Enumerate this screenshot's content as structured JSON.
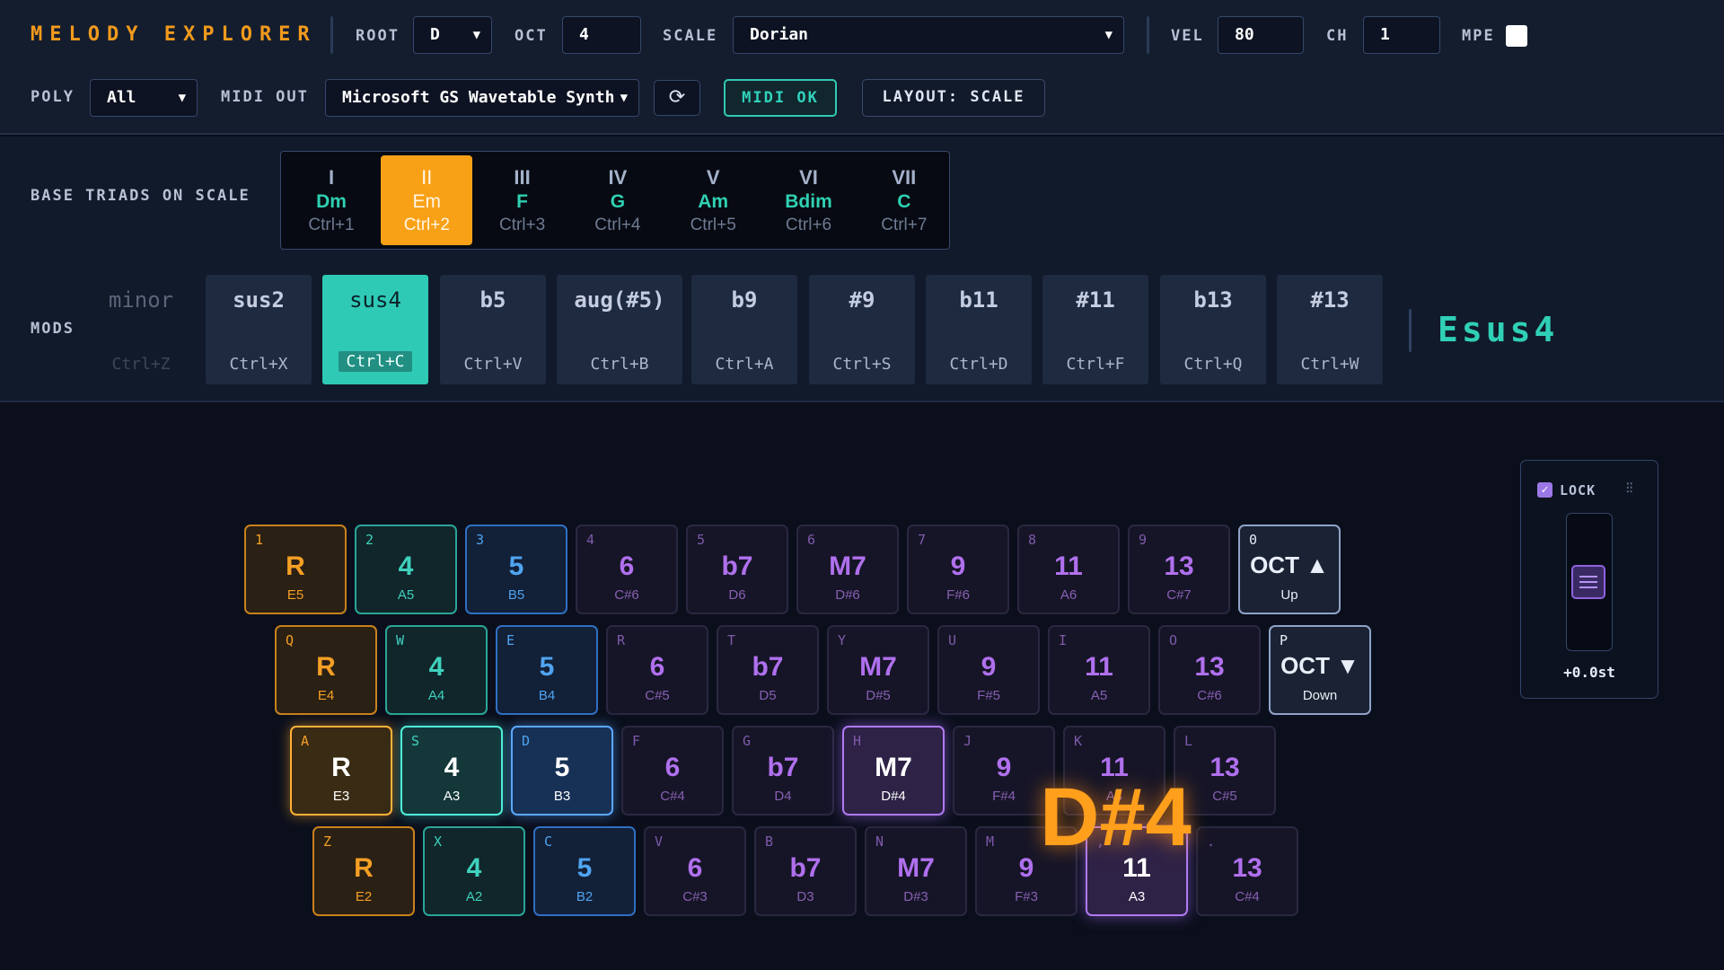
{
  "header": {
    "title": "MELODY EXPLORER",
    "root_label": "ROOT",
    "root_value": "D",
    "oct_label": "OCT",
    "oct_value": "4",
    "scale_label": "SCALE",
    "scale_value": "Dorian",
    "vel_label": "VEL",
    "vel_value": "80",
    "ch_label": "CH",
    "ch_value": "1",
    "mpe_label": "MPE",
    "poly_label": "POLY",
    "poly_value": "All",
    "midi_out_label": "MIDI OUT",
    "midi_out_value": "Microsoft GS Wavetable Synth",
    "refresh_icon": "⟳",
    "midi_status": "MIDI OK",
    "layout_button": "LAYOUT: SCALE"
  },
  "triads": {
    "label": "BASE TRIADS ON SCALE",
    "items": [
      {
        "roman": "I",
        "chord": "Dm",
        "shortcut": "Ctrl+1",
        "active": false
      },
      {
        "roman": "II",
        "chord": "Em",
        "shortcut": "Ctrl+2",
        "active": true
      },
      {
        "roman": "III",
        "chord": "F",
        "shortcut": "Ctrl+3",
        "active": false
      },
      {
        "roman": "IV",
        "chord": "G",
        "shortcut": "Ctrl+4",
        "active": false
      },
      {
        "roman": "V",
        "chord": "Am",
        "shortcut": "Ctrl+5",
        "active": false
      },
      {
        "roman": "VI",
        "chord": "Bdim",
        "shortcut": "Ctrl+6",
        "active": false
      },
      {
        "roman": "VII",
        "chord": "C",
        "shortcut": "Ctrl+7",
        "active": false
      }
    ]
  },
  "mods": {
    "label": "MODS",
    "items": [
      {
        "name": "minor",
        "shortcut": "Ctrl+Z",
        "state": "disabled"
      },
      {
        "name": "sus2",
        "shortcut": "Ctrl+X",
        "state": "normal"
      },
      {
        "name": "sus4",
        "shortcut": "Ctrl+C",
        "state": "active"
      },
      {
        "name": "b5",
        "shortcut": "Ctrl+V",
        "state": "normal"
      },
      {
        "name": "aug(#5)",
        "shortcut": "Ctrl+B",
        "state": "normal"
      },
      {
        "name": "b9",
        "shortcut": "Ctrl+A",
        "state": "normal"
      },
      {
        "name": "#9",
        "shortcut": "Ctrl+S",
        "state": "normal"
      },
      {
        "name": "b11",
        "shortcut": "Ctrl+D",
        "state": "normal"
      },
      {
        "name": "#11",
        "shortcut": "Ctrl+F",
        "state": "normal"
      },
      {
        "name": "b13",
        "shortcut": "Ctrl+Q",
        "state": "normal"
      },
      {
        "name": "#13",
        "shortcut": "Ctrl+W",
        "state": "normal"
      }
    ],
    "current_chord": "Esus4"
  },
  "keyboard": {
    "rows": [
      [
        {
          "key": "1",
          "degree": "R",
          "note": "E5",
          "color": "orange",
          "hl": false
        },
        {
          "key": "2",
          "degree": "4",
          "note": "A5",
          "color": "teal",
          "hl": false
        },
        {
          "key": "3",
          "degree": "5",
          "note": "B5",
          "color": "blue",
          "hl": false
        },
        {
          "key": "4",
          "degree": "6",
          "note": "C#6",
          "color": "purple",
          "hl": false
        },
        {
          "key": "5",
          "degree": "b7",
          "note": "D6",
          "color": "purple",
          "hl": false
        },
        {
          "key": "6",
          "degree": "M7",
          "note": "D#6",
          "color": "purple",
          "hl": false
        },
        {
          "key": "7",
          "degree": "9",
          "note": "F#6",
          "color": "purple",
          "hl": false
        },
        {
          "key": "8",
          "degree": "11",
          "note": "A6",
          "color": "purple",
          "hl": false
        },
        {
          "key": "9",
          "degree": "13",
          "note": "C#7",
          "color": "purple",
          "hl": false
        },
        {
          "key": "0",
          "degree": "OCT ▲",
          "note": "Up",
          "color": "oct",
          "hl": false
        }
      ],
      [
        {
          "key": "Q",
          "degree": "R",
          "note": "E4",
          "color": "orange",
          "hl": false
        },
        {
          "key": "W",
          "degree": "4",
          "note": "A4",
          "color": "teal",
          "hl": false
        },
        {
          "key": "E",
          "degree": "5",
          "note": "B4",
          "color": "blue",
          "hl": false
        },
        {
          "key": "R",
          "degree": "6",
          "note": "C#5",
          "color": "purple",
          "hl": false
        },
        {
          "key": "T",
          "degree": "b7",
          "note": "D5",
          "color": "purple",
          "hl": false
        },
        {
          "key": "Y",
          "degree": "M7",
          "note": "D#5",
          "color": "purple",
          "hl": false
        },
        {
          "key": "U",
          "degree": "9",
          "note": "F#5",
          "color": "purple",
          "hl": false
        },
        {
          "key": "I",
          "degree": "11",
          "note": "A5",
          "color": "purple",
          "hl": false
        },
        {
          "key": "O",
          "degree": "13",
          "note": "C#6",
          "color": "purple",
          "hl": false
        },
        {
          "key": "P",
          "degree": "OCT ▼",
          "note": "Down",
          "color": "oct",
          "hl": false
        }
      ],
      [
        {
          "key": "A",
          "degree": "R",
          "note": "E3",
          "color": "orange",
          "hl": true
        },
        {
          "key": "S",
          "degree": "4",
          "note": "A3",
          "color": "teal",
          "hl": true
        },
        {
          "key": "D",
          "degree": "5",
          "note": "B3",
          "color": "blue",
          "hl": true
        },
        {
          "key": "F",
          "degree": "6",
          "note": "C#4",
          "color": "purple",
          "hl": false
        },
        {
          "key": "G",
          "degree": "b7",
          "note": "D4",
          "color": "purple",
          "hl": false
        },
        {
          "key": "H",
          "degree": "M7",
          "note": "D#4",
          "color": "purple",
          "hl": true
        },
        {
          "key": "J",
          "degree": "9",
          "note": "F#4",
          "color": "purple",
          "hl": false
        },
        {
          "key": "K",
          "degree": "11",
          "note": "A4",
          "color": "purple",
          "hl": false
        },
        {
          "key": "L",
          "degree": "13",
          "note": "C#5",
          "color": "purple",
          "hl": false
        }
      ],
      [
        {
          "key": "Z",
          "degree": "R",
          "note": "E2",
          "color": "orange",
          "hl": false
        },
        {
          "key": "X",
          "degree": "4",
          "note": "A2",
          "color": "teal",
          "hl": false
        },
        {
          "key": "C",
          "degree": "5",
          "note": "B2",
          "color": "blue",
          "hl": false
        },
        {
          "key": "V",
          "degree": "6",
          "note": "C#3",
          "color": "purple",
          "hl": false
        },
        {
          "key": "B",
          "degree": "b7",
          "note": "D3",
          "color": "purple",
          "hl": false
        },
        {
          "key": "N",
          "degree": "M7",
          "note": "D#3",
          "color": "purple",
          "hl": false
        },
        {
          "key": "M",
          "degree": "9",
          "note": "F#3",
          "color": "purple",
          "hl": false
        },
        {
          "key": ",",
          "degree": "11",
          "note": "A3",
          "color": "purple",
          "hl": true
        },
        {
          "key": ".",
          "degree": "13",
          "note": "C#4",
          "color": "purple",
          "hl": false
        }
      ]
    ],
    "played_note": "D#4"
  },
  "pitch": {
    "lock_label": "LOCK",
    "lock_checked": true,
    "bend_value": "+0.0st",
    "bend_level": 0.5
  }
}
